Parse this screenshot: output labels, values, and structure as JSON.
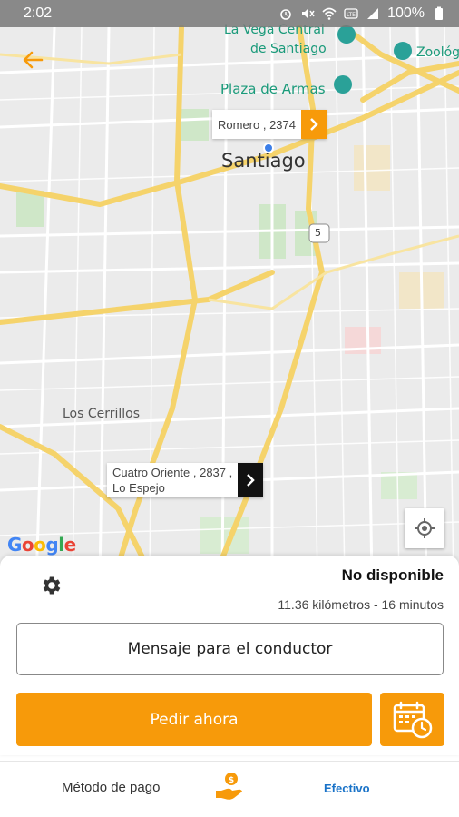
{
  "status_bar": {
    "time": "2:02",
    "battery": "100%"
  },
  "map": {
    "labels": {
      "la_vega": "La Vega Central",
      "de_santiago": "de Santiago",
      "zoologico": "Zoológ",
      "plaza_armas": "Plaza de Armas",
      "santiago": "Santiago",
      "los_cerrillos": "Los Cerrillos",
      "route_shield": "5"
    },
    "origin_pin": {
      "text": "Romero , 2374"
    },
    "destination_pin": {
      "line1": "Cuatro Oriente , 2837 ,",
      "line2": "Lo Espejo"
    },
    "google_letters": [
      "G",
      "o",
      "o",
      "g",
      "l",
      "e"
    ]
  },
  "trip": {
    "status": "No disponible",
    "distance_time": "11.36 kilómetros - 16 minutos",
    "message_button": "Mensaje para el conductor",
    "request_button": "Pedir ahora"
  },
  "payment": {
    "label": "Método de pago",
    "value": "Efectivo"
  },
  "colors": {
    "accent": "#f79a0a",
    "link": "#1a73c8",
    "user_dot": "#3b7ee8"
  },
  "icons": {
    "back": "arrow-left-icon",
    "gear": "gear-icon",
    "schedule": "calendar-clock-icon",
    "payment": "hand-coin-icon",
    "locate": "crosshair-icon"
  }
}
